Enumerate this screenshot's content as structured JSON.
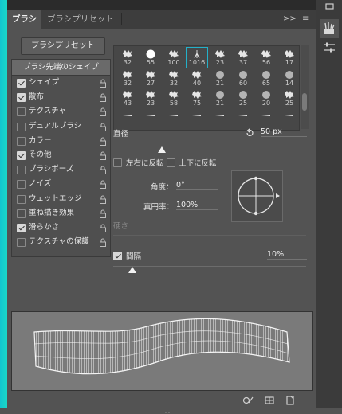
{
  "tabs": [
    {
      "label": "ブラシ",
      "active": true
    },
    {
      "label": "ブラシプリセット",
      "active": false
    }
  ],
  "tabbar_right": {
    "collapse": ">>",
    "menu": "≡"
  },
  "preset_button": "ブラシプリセット",
  "tip_shape_header": "ブラシ先端のシェイプ",
  "options": [
    {
      "label": "シェイプ",
      "checked": true
    },
    {
      "label": "散布",
      "checked": true
    },
    {
      "label": "テクスチャ",
      "checked": false
    },
    {
      "label": "デュアルブラシ",
      "checked": false
    },
    {
      "label": "カラー",
      "checked": false
    },
    {
      "label": "その他",
      "checked": true
    },
    {
      "label": "ブラシポーズ",
      "checked": false
    },
    {
      "label": "ノイズ",
      "checked": false
    },
    {
      "label": "ウェットエッジ",
      "checked": false
    },
    {
      "label": "重ね描き効果",
      "checked": false
    },
    {
      "label": "滑らかさ",
      "checked": true
    },
    {
      "label": "テクスチャの保護",
      "checked": false
    }
  ],
  "brushes": [
    [
      "32",
      "55",
      "100",
      "1016",
      "23",
      "37",
      "56",
      "17"
    ],
    [
      "32",
      "27",
      "32",
      "40",
      "21",
      "60",
      "65",
      "14"
    ],
    [
      "43",
      "23",
      "58",
      "75",
      "21",
      "25",
      "20",
      "25"
    ],
    [
      "",
      "",
      "",
      "",
      "",
      "",
      "",
      ""
    ]
  ],
  "selected_brush": "1016",
  "size": {
    "label": "直径",
    "value": "50 px",
    "fraction": 0.25
  },
  "flip_x": {
    "label": "左右に反転",
    "checked": false
  },
  "flip_y": {
    "label": "上下に反転",
    "checked": false
  },
  "angle": {
    "label": "角度：",
    "value": "0°"
  },
  "roundness": {
    "label": "真円率：",
    "value": "100%"
  },
  "hardness": {
    "label": "硬さ"
  },
  "spacing": {
    "label": "間隔",
    "checked": true,
    "value": "10%",
    "fraction": 0.1
  },
  "colors": {
    "accent": "#23b1c9",
    "panel": "#535353",
    "dark": "#3b3b3b"
  },
  "icons": {
    "dock_1": "brush-tool-icon",
    "dock_2": "sliders-icon",
    "bottom_1": "brush-reset-icon",
    "bottom_2": "grid-icon",
    "bottom_3": "new-brush-icon"
  }
}
